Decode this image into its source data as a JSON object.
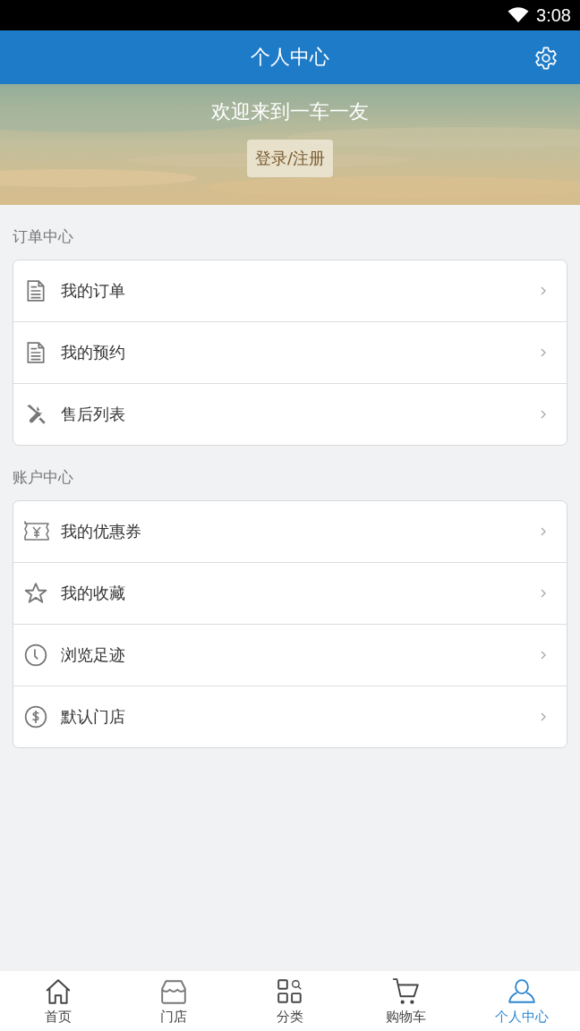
{
  "status_bar": {
    "time": "3:08"
  },
  "header": {
    "title": "个人中心"
  },
  "banner": {
    "kind": "picture",
    "welcome": "欢迎来到一车一友",
    "login_button": "登录/注册"
  },
  "sections": [
    {
      "title": "订单中心",
      "items": [
        {
          "label": "我的订单",
          "kind": "document"
        },
        {
          "label": "我的预约",
          "kind": "document"
        },
        {
          "label": "售后列表",
          "kind": "tools"
        }
      ]
    },
    {
      "title": "账户中心",
      "items": [
        {
          "label": "我的优惠券",
          "kind": "coupon"
        },
        {
          "label": "我的收藏",
          "kind": "star"
        },
        {
          "label": "浏览足迹",
          "kind": "clock"
        },
        {
          "label": "默认门店",
          "kind": "dollar"
        }
      ]
    }
  ],
  "tab_bar": [
    {
      "label": "首页",
      "kind": "home",
      "selected": false
    },
    {
      "label": "门店",
      "kind": "store",
      "selected": false
    },
    {
      "label": "分类",
      "kind": "category",
      "selected": false
    },
    {
      "label": "购物车",
      "kind": "cart",
      "selected": false
    },
    {
      "label": "个人中心",
      "kind": "person",
      "selected": true
    }
  ]
}
